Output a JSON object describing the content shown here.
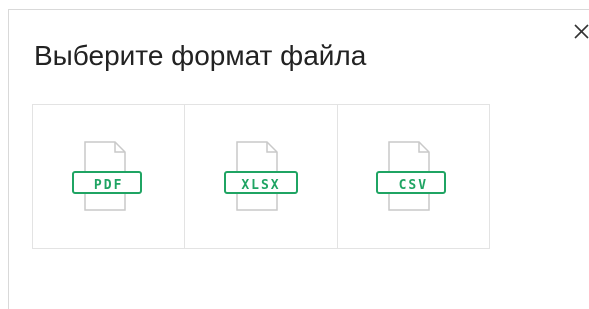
{
  "dialog": {
    "title": "Выберите формат файла",
    "close_icon": "close-icon",
    "accent_color": "#1fa463",
    "formats": [
      {
        "label": "PDF",
        "icon": "file-pdf-icon"
      },
      {
        "label": "XLSX",
        "icon": "file-xlsx-icon"
      },
      {
        "label": "CSV",
        "icon": "file-csv-icon"
      }
    ]
  }
}
